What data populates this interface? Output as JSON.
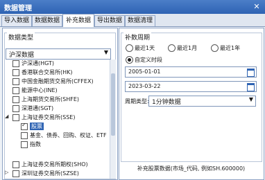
{
  "window": {
    "title": "数据管理",
    "close_glyph": "✕"
  },
  "tabs": [
    {
      "label": "导入数据"
    },
    {
      "label": "数据数据"
    },
    {
      "label": "补充数据"
    },
    {
      "label": "导出数据"
    },
    {
      "label": "数据清理"
    }
  ],
  "left": {
    "group_title": "数据类型",
    "dropdown_value": "沪深数据",
    "tree": [
      {
        "label": "沪深通(HGT)",
        "checked": false
      },
      {
        "label": "香港联合交易所(HK)",
        "checked": false
      },
      {
        "label": "中国金融期货交易所(CFFEX)",
        "checked": false
      },
      {
        "label": "能源中心(INE)",
        "checked": false
      },
      {
        "label": "上海期货交易所(SHFE)",
        "checked": false
      },
      {
        "label": "深港通(SGT)",
        "checked": false
      },
      {
        "label": "上海证券交易所(SSE)",
        "checked": false,
        "expanded": true
      },
      {
        "label": "股票",
        "checked": true,
        "child": true,
        "selected": true
      },
      {
        "label": "基金、债券、回购、权证、ETF",
        "checked": false,
        "child": true
      },
      {
        "label": "指数",
        "checked": false,
        "child": true
      },
      {
        "label": "上海证券交易所期权(SHO)",
        "checked": false
      },
      {
        "label": "深圳证券交易所(SZSE)",
        "checked": false
      }
    ]
  },
  "right": {
    "group_title": "补数周期",
    "radios": [
      {
        "label": "最近1天",
        "on": false
      },
      {
        "label": "最近1月",
        "on": false
      },
      {
        "label": "最近1年",
        "on": false
      },
      {
        "label": "自定义时段",
        "on": true
      }
    ],
    "start_date": "2005-01-01",
    "end_date": "2023-03-22",
    "period_label": "周期类型:",
    "period_value": "1分钟数据",
    "bottom_text": "补充股票数据(市场_代码, 例如SH.600000)"
  }
}
